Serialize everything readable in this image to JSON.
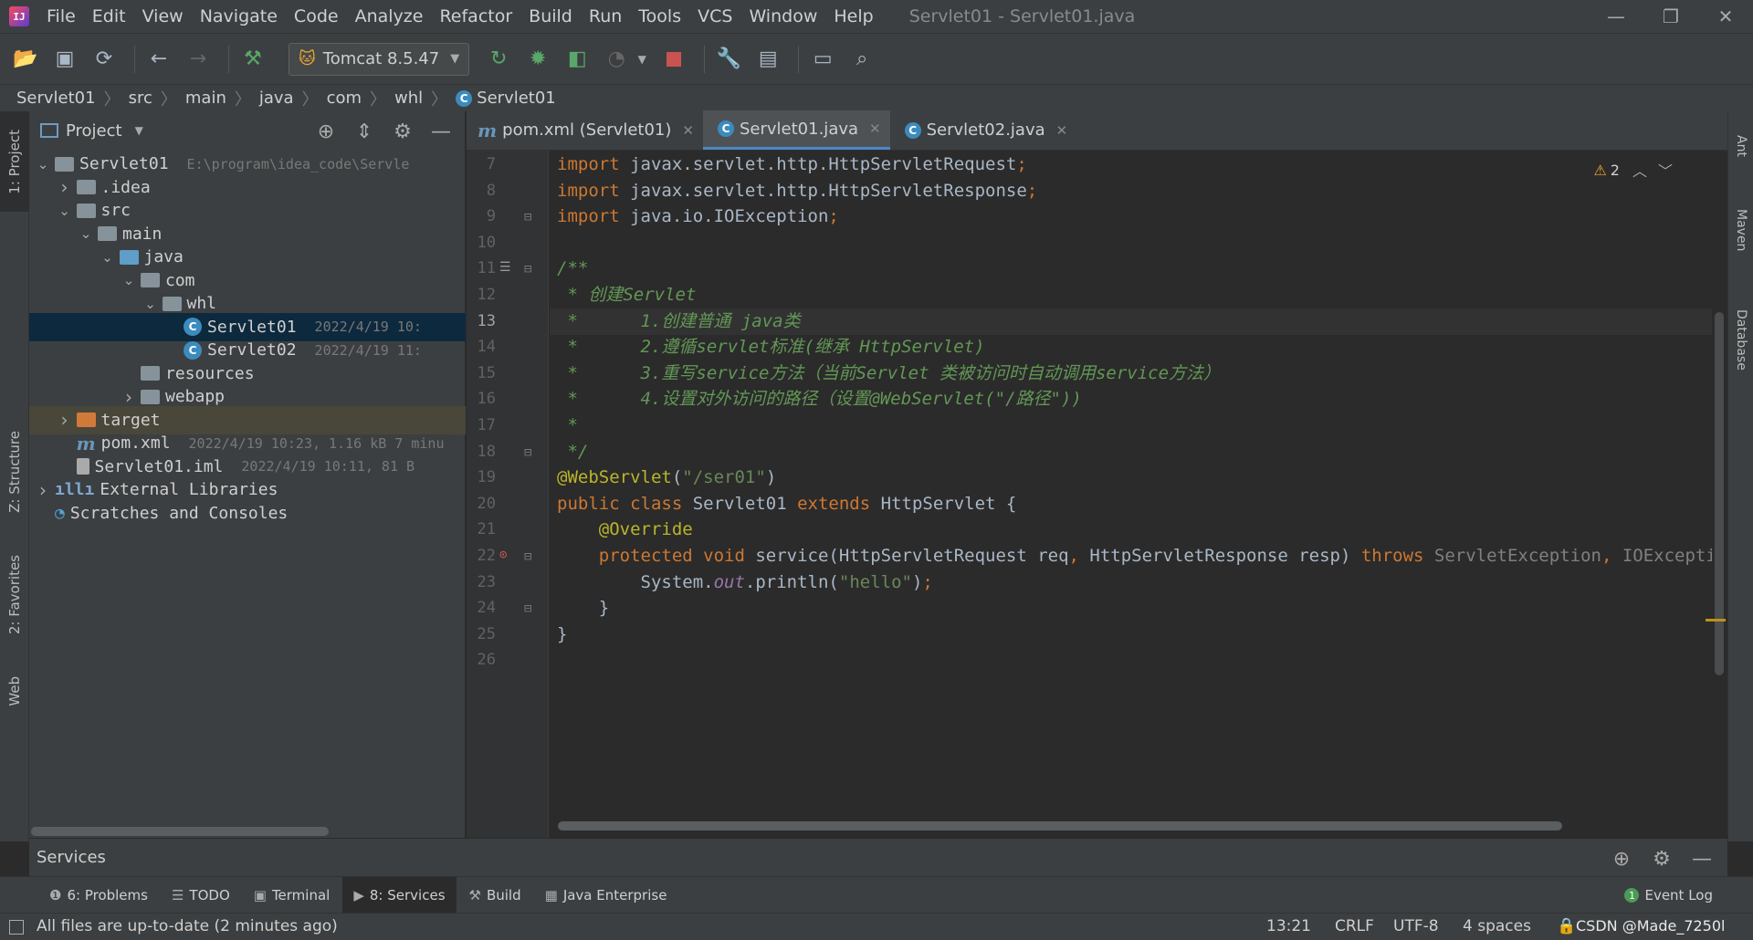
{
  "app": {
    "window_title": "Servlet01 - Servlet01.java",
    "menu": [
      "File",
      "Edit",
      "View",
      "Navigate",
      "Code",
      "Analyze",
      "Refactor",
      "Build",
      "Run",
      "Tools",
      "VCS",
      "Window",
      "Help"
    ]
  },
  "toolbar": {
    "run_config": "Tomcat 8.5.47"
  },
  "breadcrumb": [
    "Servlet01",
    "src",
    "main",
    "java",
    "com",
    "whl",
    "Servlet01"
  ],
  "left_strip": {
    "project": "1: Project",
    "structure": "Z: Structure",
    "favorites": "2: Favorites",
    "web": "Web"
  },
  "right_strip": {
    "ant": "Ant",
    "maven": "Maven",
    "database": "Database"
  },
  "project_panel": {
    "title": "Project",
    "tree": [
      {
        "label": "Servlet01",
        "meta": "E:\\program\\idea_code\\Servle",
        "depth": 0,
        "icon": "module-folder",
        "expanded": true
      },
      {
        "label": ".idea",
        "meta": "",
        "depth": 1,
        "icon": "folder",
        "expanded": false
      },
      {
        "label": "src",
        "meta": "",
        "depth": 1,
        "icon": "folder",
        "expanded": true
      },
      {
        "label": "main",
        "meta": "",
        "depth": 2,
        "icon": "folder",
        "expanded": true
      },
      {
        "label": "java",
        "meta": "",
        "depth": 3,
        "icon": "source-folder",
        "expanded": true
      },
      {
        "label": "com",
        "meta": "",
        "depth": 4,
        "icon": "package",
        "expanded": true
      },
      {
        "label": "whl",
        "meta": "",
        "depth": 5,
        "icon": "package",
        "expanded": true
      },
      {
        "label": "Servlet01",
        "meta": "2022/4/19 10:",
        "depth": 6,
        "icon": "class",
        "selected": true
      },
      {
        "label": "Servlet02",
        "meta": "2022/4/19 11:",
        "depth": 6,
        "icon": "class"
      },
      {
        "label": "resources",
        "meta": "",
        "depth": 4,
        "icon": "resources-folder"
      },
      {
        "label": "webapp",
        "meta": "",
        "depth": 4,
        "icon": "web-folder",
        "expanded": false
      },
      {
        "label": "target",
        "meta": "",
        "depth": 1,
        "icon": "excluded-folder",
        "expanded": false,
        "excluded": true
      },
      {
        "label": "pom.xml",
        "meta": "2022/4/19 10:23, 1.16 kB 7 minu",
        "depth": 1,
        "icon": "maven-file"
      },
      {
        "label": "Servlet01.iml",
        "meta": "2022/4/19 10:11, 81 B",
        "depth": 1,
        "icon": "iml-file"
      },
      {
        "label": "External Libraries",
        "meta": "",
        "depth": 0,
        "icon": "libraries",
        "expanded": false
      },
      {
        "label": "Scratches and Consoles",
        "meta": "",
        "depth": 0,
        "icon": "scratches"
      }
    ]
  },
  "editor": {
    "tabs": [
      {
        "label": "pom.xml (Servlet01)",
        "icon": "maven-icon",
        "active": false
      },
      {
        "label": "Servlet01.java",
        "icon": "class-icon",
        "active": true
      },
      {
        "label": "Servlet02.java",
        "icon": "class-icon",
        "active": false
      }
    ],
    "warnings": "2",
    "current_line": "13",
    "lines": [
      {
        "n": "7",
        "tokens": [
          [
            "kw",
            "import"
          ],
          [
            "pl",
            " javax.servlet.http.HttpServletRequest"
          ],
          [
            "kw",
            ";"
          ]
        ]
      },
      {
        "n": "8",
        "tokens": [
          [
            "kw",
            "import"
          ],
          [
            "pl",
            " javax.servlet.http.HttpServletResponse"
          ],
          [
            "kw",
            ";"
          ]
        ]
      },
      {
        "n": "9",
        "tokens": [
          [
            "kw",
            "import"
          ],
          [
            "pl",
            " java.io.IOException"
          ],
          [
            "kw",
            ";"
          ]
        ]
      },
      {
        "n": "10",
        "tokens": []
      },
      {
        "n": "11",
        "tokens": [
          [
            "cmt",
            "/**"
          ]
        ]
      },
      {
        "n": "12",
        "tokens": [
          [
            "cmt",
            " * 创建Servlet"
          ]
        ]
      },
      {
        "n": "13",
        "tokens": [
          [
            "cmt",
            " *      1.创建普通 java类"
          ]
        ]
      },
      {
        "n": "14",
        "tokens": [
          [
            "cmt",
            " *      2.遵循servlet标准(继承 HttpServlet)"
          ]
        ]
      },
      {
        "n": "15",
        "tokens": [
          [
            "cmt",
            " *      3.重写service方法（当前Servlet 类被访问时自动调用service方法）"
          ]
        ]
      },
      {
        "n": "16",
        "tokens": [
          [
            "cmt",
            " *      4.设置对外访问的路径（设置@WebServlet(\"/路径\"))"
          ]
        ]
      },
      {
        "n": "17",
        "tokens": [
          [
            "cmt",
            " *"
          ]
        ]
      },
      {
        "n": "18",
        "tokens": [
          [
            "cmt",
            " */"
          ]
        ]
      },
      {
        "n": "19",
        "tokens": [
          [
            "ann",
            "@WebServlet"
          ],
          [
            "pl",
            "("
          ],
          [
            "str",
            "\"/ser01\""
          ],
          [
            "pl",
            ")"
          ]
        ]
      },
      {
        "n": "20",
        "tokens": [
          [
            "kw",
            "public class "
          ],
          [
            "pl",
            "Servlet01 "
          ],
          [
            "kw",
            "extends "
          ],
          [
            "pl",
            "HttpServlet {"
          ]
        ]
      },
      {
        "n": "21",
        "tokens": [
          [
            "pl",
            "    "
          ],
          [
            "ann",
            "@Override"
          ]
        ]
      },
      {
        "n": "22",
        "tokens": [
          [
            "pl",
            "    "
          ],
          [
            "kw",
            "protected void "
          ],
          [
            "pl",
            "service(HttpServletRequest req"
          ],
          [
            "kw",
            ", "
          ],
          [
            "pl",
            "HttpServletResponse resp) "
          ],
          [
            "kw",
            "throws "
          ],
          [
            "gr",
            "ServletException"
          ],
          [
            "kw",
            ", "
          ],
          [
            "gr",
            "IOException"
          ]
        ]
      },
      {
        "n": "23",
        "tokens": [
          [
            "pl",
            "        System."
          ],
          [
            "fld",
            "out"
          ],
          [
            "pl",
            ".println("
          ],
          [
            "str",
            "\"hello\""
          ],
          [
            "pl",
            ")"
          ],
          [
            "kw",
            ";"
          ]
        ]
      },
      {
        "n": "24",
        "tokens": [
          [
            "pl",
            "    }"
          ]
        ]
      },
      {
        "n": "25",
        "tokens": [
          [
            "pl",
            "}"
          ]
        ]
      },
      {
        "n": "26",
        "tokens": []
      }
    ]
  },
  "services": {
    "title": "Services"
  },
  "tool_windows": [
    {
      "label": "6: Problems",
      "icon": "problems-icon"
    },
    {
      "label": "TODO",
      "icon": "todo-icon"
    },
    {
      "label": "Terminal",
      "icon": "terminal-icon"
    },
    {
      "label": "8: Services",
      "icon": "services-icon",
      "active": true
    },
    {
      "label": "Build",
      "icon": "build-icon"
    },
    {
      "label": "Java Enterprise",
      "icon": "java-enterprise-icon"
    }
  ],
  "event_log": {
    "label": "Event Log",
    "badge": "1"
  },
  "status": {
    "message": "All files are up-to-date (2 minutes ago)",
    "position": "13:21",
    "line_sep": "CRLF",
    "encoding": "UTF-8",
    "indent": "4 spaces",
    "watermark": "CSDN @Made_7250l"
  }
}
